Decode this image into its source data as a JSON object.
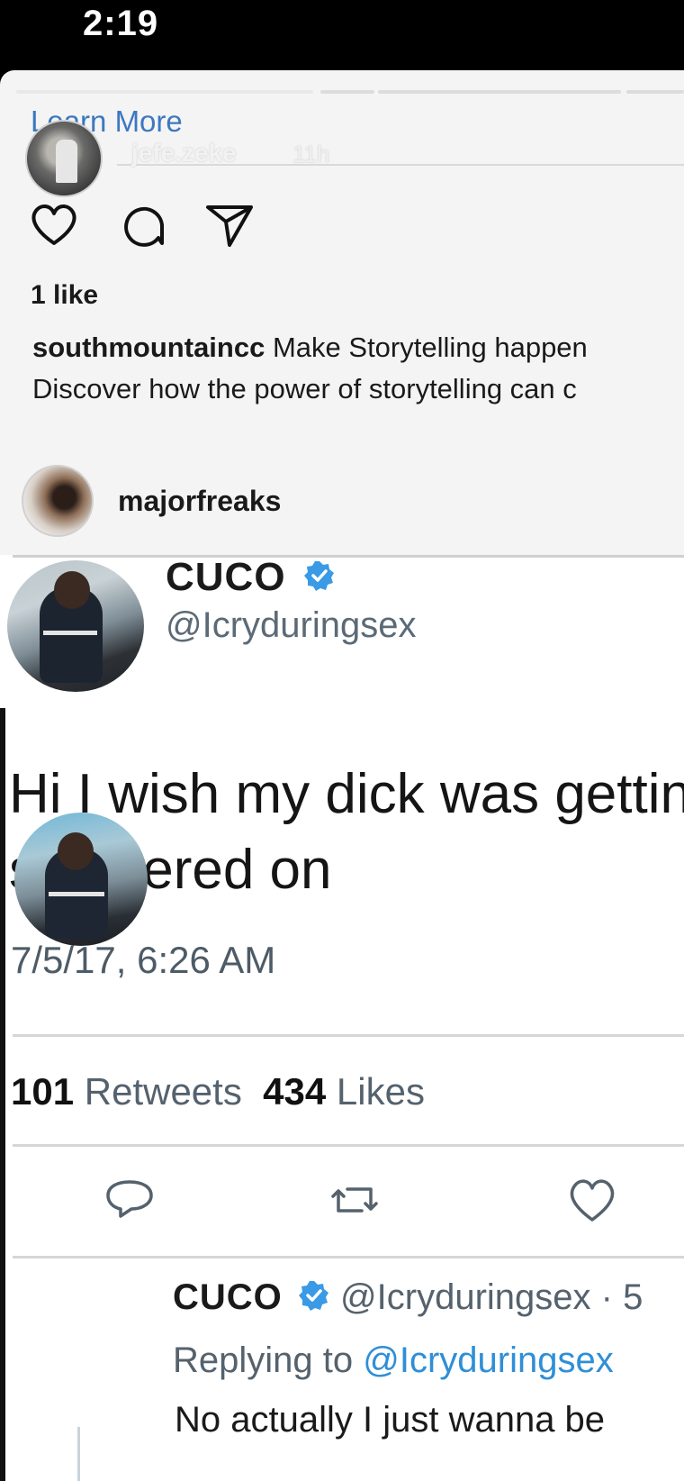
{
  "status_bar": {
    "time": "2:19"
  },
  "story": {
    "learn_more": "Learn More",
    "username": "jefe.zeke",
    "time_ago": "11h",
    "likes": "1 like",
    "caption_user": "southmountaincc",
    "caption_line1": "Make Storytelling happen",
    "caption_line2": "Discover how the power of storytelling can c",
    "comment_user": "majorfreaks"
  },
  "tweet": {
    "name": "CUCO",
    "handle": "@Icryduringsex",
    "text_line1": "Hi I wish my dick was gettin",
    "text_line2": "slobbered on",
    "date": "7/5/17, 6:26 AM",
    "retweets_count": "101",
    "retweets_label": "Retweets",
    "likes_count": "434",
    "likes_label": "Likes"
  },
  "reply": {
    "name": "CUCO",
    "handle": "@Icryduringsex",
    "time_sep": "· 5",
    "replying_prefix": "Replying to",
    "replying_handle": "@Icryduringsex",
    "text": "No actually I just wanna be"
  },
  "colors": {
    "link_blue": "#3d78bf",
    "verified_blue": "#3a9ae6",
    "twitter_gray": "#55626d"
  }
}
